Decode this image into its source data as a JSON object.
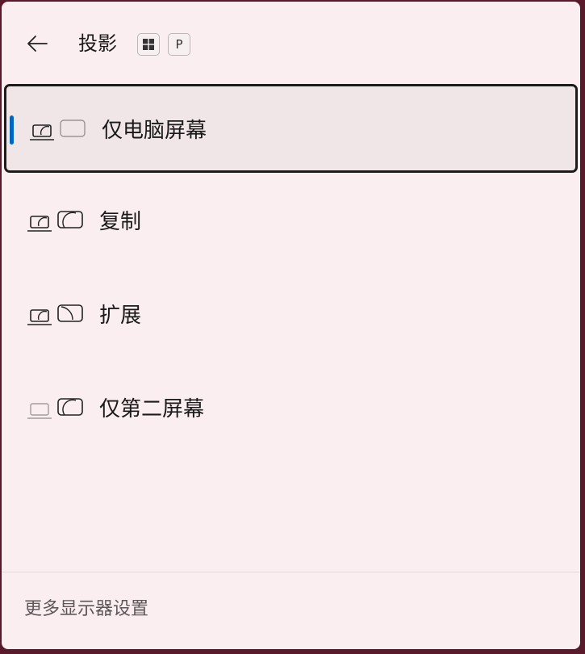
{
  "header": {
    "back_icon": "arrow-left-icon",
    "title": "投影",
    "shortcut_keys": {
      "windows_icon": "windows-logo-icon",
      "letter": "P"
    }
  },
  "options": [
    {
      "label": "仅电脑屏幕",
      "icon": "pc-screen-only-icon",
      "selected": true
    },
    {
      "label": "复制",
      "icon": "duplicate-icon",
      "selected": false
    },
    {
      "label": "扩展",
      "icon": "extend-icon",
      "selected": false
    },
    {
      "label": "仅第二屏幕",
      "icon": "second-screen-only-icon",
      "selected": false
    }
  ],
  "footer": {
    "link_label": "更多显示器设置"
  },
  "colors": {
    "accent": "#0067c0",
    "background": "#fbeef0",
    "selected_bg": "#f0e6e8"
  }
}
